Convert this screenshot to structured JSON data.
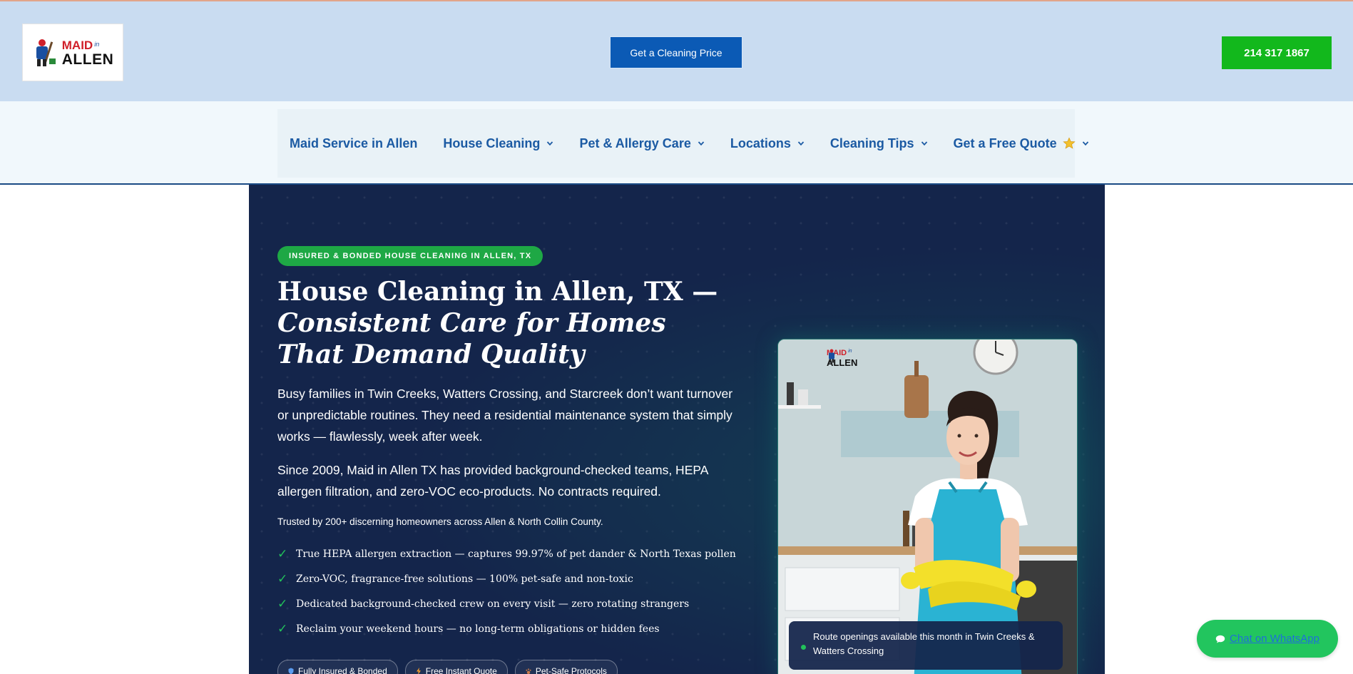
{
  "header": {
    "logo": {
      "maid": "MAID",
      "in": "in",
      "allen": "ALLEN"
    },
    "cta_price": "Get a Cleaning Price",
    "cta_phone": "214 317 1867"
  },
  "nav": {
    "items": [
      {
        "label": "Maid Service in Allen",
        "dropdown": false
      },
      {
        "label": "House Cleaning",
        "dropdown": true
      },
      {
        "label": "Pet & Allergy Care",
        "dropdown": true
      },
      {
        "label": "Locations",
        "dropdown": true
      },
      {
        "label": "Cleaning Tips",
        "dropdown": true
      },
      {
        "label": "Get a Free Quote",
        "dropdown": true,
        "icon": "star-icon"
      }
    ]
  },
  "hero": {
    "pill": "INSURED & BONDED HOUSE CLEANING IN ALLEN, TX",
    "title_line1": "House Cleaning in Allen, TX —",
    "title_line2": "Consistent Care for Homes That Demand Quality",
    "paragraph1": "Busy families in Twin Creeks, Watters Crossing, and Starcreek don’t want turnover or unpredictable routines. They need a residential maintenance system that simply works — flawlessly, week after week.",
    "paragraph2": "Since 2009, Maid in Allen TX has provided background-checked teams, HEPA allergen filtration, and zero-VOC eco-products. No contracts required.",
    "trust": "Trusted by 200+ discerning homeowners across Allen & North Collin County.",
    "checks": [
      "True HEPA allergen extraction — captures 99.97% of pet dander & North Texas pollen",
      "Zero-VOC, fragrance-free solutions — 100% pet-safe and non-toxic",
      "Dedicated background-checked crew on every visit — zero rotating strangers",
      "Reclaim your weekend hours — no long-term obligations or hidden fees"
    ],
    "badges": [
      {
        "label": "Fully Insured & Bonded",
        "icon": "shield-icon"
      },
      {
        "label": "Free Instant Quote",
        "icon": "lightning-icon"
      },
      {
        "label": "Pet-Safe Protocols",
        "icon": "paw-icon"
      }
    ],
    "photo_logo": {
      "maid": "MAID",
      "in": "in",
      "allen": "ALLEN"
    },
    "route_note": "Route openings available this month in Twin Creeks & Watters Crossing"
  },
  "whatsapp": {
    "label": "Chat on WhatsApp",
    "icon": "chat-bubble-icon"
  },
  "colors": {
    "header_bg": "#c9dcf1",
    "nav_bg": "#f1f8fc",
    "nav_text": "#1b5aa3",
    "hero_bg": "#14254b",
    "primary_blue": "#0b5ab5",
    "phone_green": "#12b81c",
    "accent_green": "#1ea845",
    "whatsapp_green": "#22c55e"
  }
}
